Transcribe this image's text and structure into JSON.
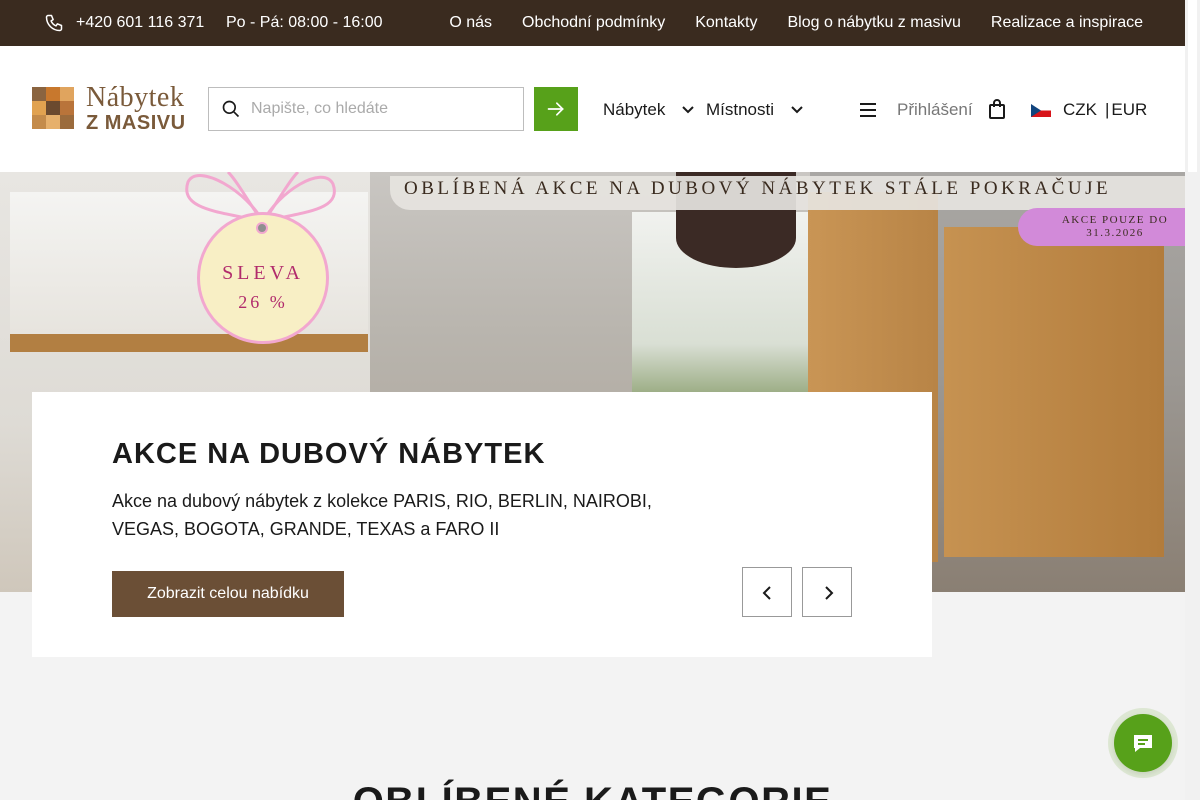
{
  "topbar": {
    "phone": "+420 601 116 371",
    "hours": "Po - Pá: 08:00 - 16:00",
    "links": [
      "O nás",
      "Obchodní podmínky",
      "Kontakty",
      "Blog o nábytku z masivu",
      "Realizace a inspirace"
    ]
  },
  "logo": {
    "line1": "Nábytek",
    "line2": "Z MASIVU"
  },
  "search": {
    "placeholder": "Napište, co hledáte"
  },
  "nav": {
    "nabytek": "Nábytek",
    "mistnosti": "Místnosti"
  },
  "account": {
    "login": "Přihlášení"
  },
  "currency": {
    "czk": "CZK",
    "sep": "|",
    "eur": "EUR"
  },
  "hero": {
    "banner": "OBLÍBENÁ AKCE NA DUBOVÝ NÁBYTEK STÁLE POKRAČUJE",
    "promo_line1": "AKCE POUZE DO",
    "promo_line2": "31.3.2026",
    "tag_line1": "SLEVA",
    "tag_line2": "26 %",
    "title": "AKCE NA DUBOVÝ NÁBYTEK",
    "description": "Akce na dubový nábytek z kolekce PARIS, RIO, BERLIN, NAIROBI, VEGAS, BOGOTA, GRANDE, TEXAS a FARO II",
    "cta": "Zobrazit celou nabídku"
  },
  "section": {
    "title": "OBLÍBENÉ KATEGORIE"
  },
  "colors": {
    "topbar": "#3a2b1f",
    "accent_green": "#57a11a",
    "brand_brown": "#6b4f36",
    "logo_brown": "#7a5a3a"
  },
  "icons": {
    "phone": "phone-icon",
    "search": "search-icon",
    "submit": "arrow-right-icon",
    "dropdown": "chevron-down-icon",
    "menu": "menu-icon",
    "bag": "shopping-bag-icon",
    "flag": "czech-flag-icon",
    "prev": "chevron-left-icon",
    "next": "chevron-right-icon",
    "chat": "chat-icon"
  }
}
